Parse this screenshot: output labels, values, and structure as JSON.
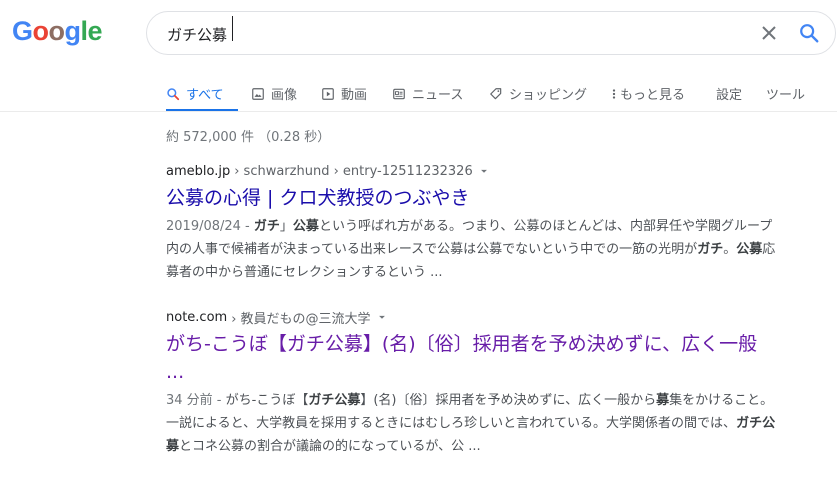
{
  "logo": {
    "letters": [
      "G",
      "o",
      "o",
      "g",
      "l",
      "e"
    ],
    "colors": [
      "#4285f4",
      "#ea4335",
      "#fbbc05",
      "#4285f4",
      "#34a853",
      "#34a853"
    ]
  },
  "search": {
    "query": "ガチ公募"
  },
  "tabs": [
    {
      "label": "すべて",
      "icon": "search-icon",
      "active": true
    },
    {
      "label": "画像",
      "icon": "image-icon"
    },
    {
      "label": "動画",
      "icon": "video-icon"
    },
    {
      "label": "ニュース",
      "icon": "news-icon"
    },
    {
      "label": "ショッピング",
      "icon": "tag-icon"
    },
    {
      "label": "もっと見る",
      "icon": "more-vert-icon"
    },
    {
      "label": "設定"
    },
    {
      "label": "ツール"
    }
  ],
  "stats": "約 572,000 件 （0.28 秒）",
  "results": [
    {
      "site": "ameblo.jp",
      "path": "› schwarzhund › entry-12511232326",
      "title": "公募の心得 | クロ犬教授のつぶやき",
      "date": "2019/08/24 - ",
      "snippet": [
        {
          "t": "ガチ",
          "b": true
        },
        {
          "t": "」"
        },
        {
          "t": "公募",
          "b": true
        },
        {
          "t": "という呼ばれ方がある。つまり、公募のほとんどは、内部昇任や学閥グループ内の人事で候補者が決まっている出来レースで公募は公募でないという中での一筋の光明が"
        },
        {
          "t": "ガチ",
          "b": true
        },
        {
          "t": "。"
        },
        {
          "t": "公募",
          "b": true
        },
        {
          "t": "応募者の中から普通にセレクションするという ..."
        }
      ]
    },
    {
      "site": "note.com",
      "path": "› 教員だもの@三流大学",
      "title": "がち-こうぼ【ガチ公募】(名)〔俗〕採用者を予め決めずに、広く一般 ...",
      "date": "34 分前 - ",
      "snippet": [
        {
          "t": "がち-こうぼ【"
        },
        {
          "t": "ガチ公募",
          "b": true
        },
        {
          "t": "】(名)〔俗〕採用者を予め決めずに、広く一般から"
        },
        {
          "t": "募",
          "b": true
        },
        {
          "t": "集をかけること。一説によると、大学教員を採用するときにはむしろ珍しいと言われている。大学関係者の間では、"
        },
        {
          "t": "ガチ公募",
          "b": true
        },
        {
          "t": "とコネ公募の割合が議論の的になっているが、公 ..."
        }
      ]
    }
  ]
}
